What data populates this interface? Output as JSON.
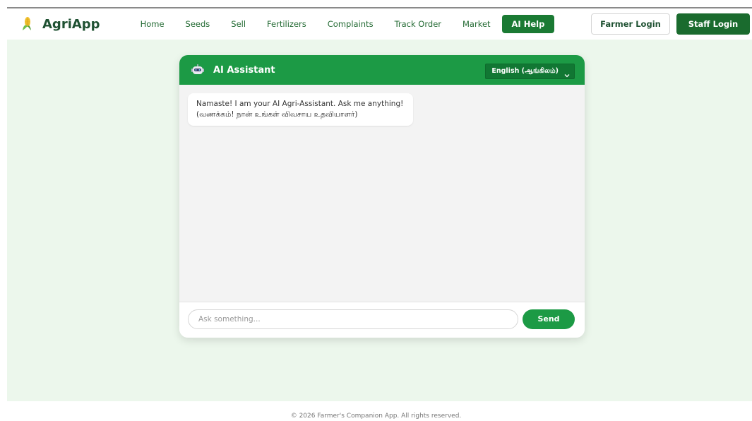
{
  "brand": {
    "name": "AgriApp",
    "icon": "corn-icon"
  },
  "nav": {
    "links": [
      "Home",
      "Seeds",
      "Sell",
      "Fertilizers",
      "Complaints",
      "Track Order",
      "Market"
    ],
    "ai_help": "AI Help",
    "farmer_login": "Farmer Login",
    "staff_login": "Staff Login"
  },
  "chat": {
    "title": "AI Assistant",
    "bot_icon": "robot-icon",
    "language": "English (ஆங்கிலம்)",
    "welcome_line1": "Namaste! I am your AI Agri-Assistant. Ask me anything!",
    "welcome_line2": "(வணக்கம்! நான் உங்கள் விவசாய உதவியாளர்)",
    "input_placeholder": "Ask something...",
    "send_label": "Send"
  },
  "footer": {
    "text": "© 2026 Farmer's Companion App. All rights reserved."
  },
  "colors": {
    "primary": "#1c9a45",
    "dark_green": "#1a6b2e",
    "page_bg": "#ecf7ec"
  }
}
